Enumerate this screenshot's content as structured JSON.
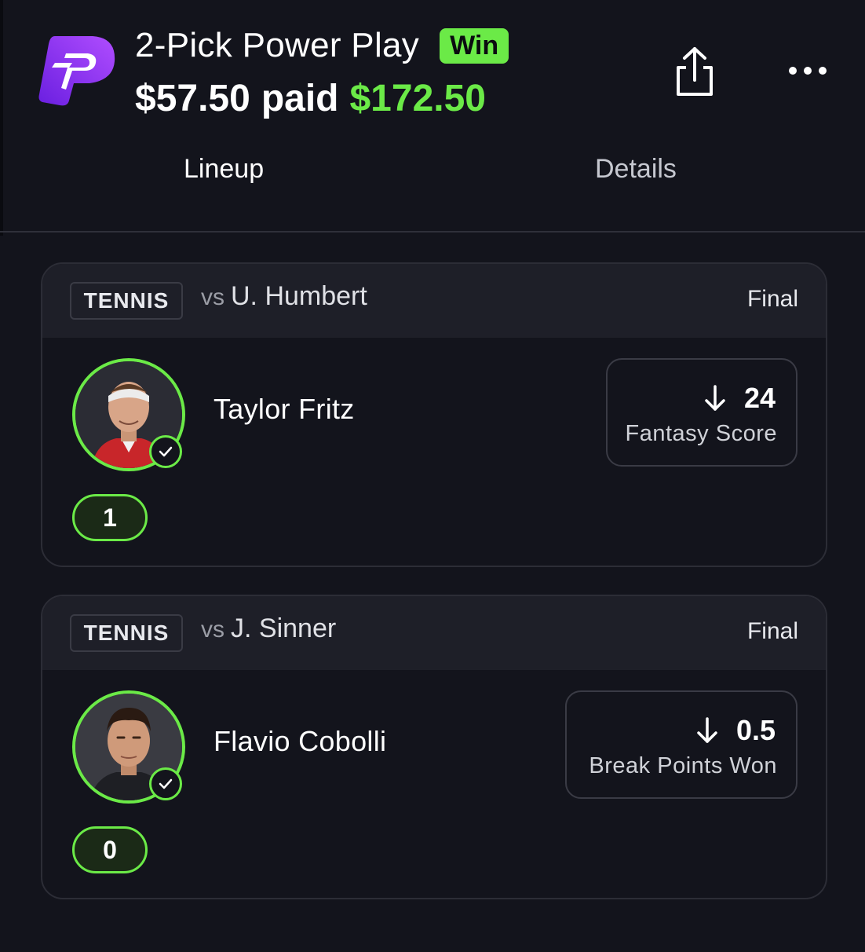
{
  "header": {
    "title": "2-Pick Power Play",
    "badge": "Win",
    "paid_amount": "$57.50",
    "paid_word": "paid",
    "won_amount": "$172.50",
    "colors": {
      "accent": "#6bea47",
      "brand": "#7b2ff2",
      "background": "#13141c"
    },
    "icons": {
      "logo": "prizepicks-logo",
      "share": "share-icon",
      "more": "more-icon"
    }
  },
  "tabs": [
    {
      "label": "Lineup",
      "active": true
    },
    {
      "label": "Details",
      "active": false
    }
  ],
  "picks": [
    {
      "sport": "TENNIS",
      "vs_word": "vs",
      "opponent": "U. Humbert",
      "status": "Final",
      "player": "Taylor Fritz",
      "direction": "down",
      "line": "24",
      "stat": "Fantasy Score",
      "result": "1"
    },
    {
      "sport": "TENNIS",
      "vs_word": "vs",
      "opponent": "J. Sinner",
      "status": "Final",
      "player": "Flavio Cobolli",
      "direction": "down",
      "line": "0.5",
      "stat": "Break Points Won",
      "result": "0"
    }
  ]
}
